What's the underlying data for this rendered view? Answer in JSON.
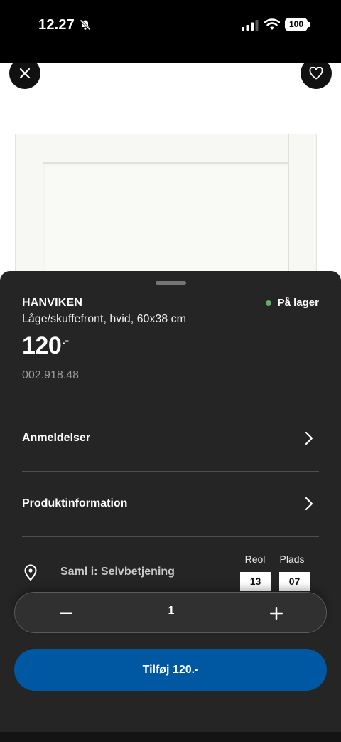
{
  "status_bar": {
    "time": "12.27",
    "battery": "100"
  },
  "product": {
    "name": "HANVIKEN",
    "description": "Låge/skuffefront, hvid, 60x38 cm",
    "price": "120",
    "price_suffix": ".-",
    "article_number": "002.918.48",
    "stock_status": "På lager"
  },
  "sections": {
    "reviews": "Anmeldelser",
    "product_info": "Produktinformation"
  },
  "pickup": {
    "label": "Saml i: Selvbetjening",
    "aisle_label": "Reol",
    "aisle_value": "13",
    "location_label": "Plads",
    "location_value": "07"
  },
  "quantity": {
    "value": "1"
  },
  "add_button": {
    "label": "Tilføj 120.-"
  },
  "colors": {
    "sheet_bg": "#252525",
    "accent_blue": "#0058a3",
    "in_stock_green": "#5bb55f"
  },
  "icons": [
    "bell-slash-icon",
    "signal-icon",
    "wifi-icon",
    "close-icon",
    "heart-icon",
    "chevron-right-icon",
    "location-pin-icon",
    "minus-icon",
    "plus-icon"
  ]
}
